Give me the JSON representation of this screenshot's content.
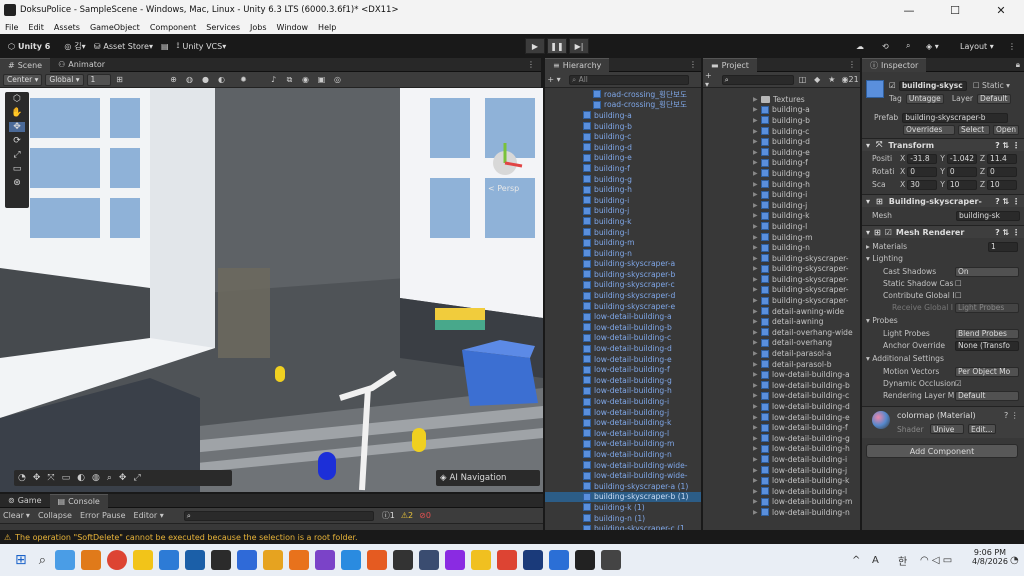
{
  "window": {
    "title": "DoksuPolice - SampleScene - Windows, Mac, Linux - Unity 6.3 LTS (6000.3.6f1)* <DX11>",
    "minimize": "—",
    "maximize": "☐",
    "close": "✕"
  },
  "menu": [
    "File",
    "Edit",
    "Assets",
    "GameObject",
    "Component",
    "Services",
    "Jobs",
    "Window",
    "Help"
  ],
  "toolbar": {
    "unity": "Unity 6",
    "account": "김",
    "asset_store": "Asset Store",
    "vcs": "Unity VCS",
    "layout": "Layout"
  },
  "scene": {
    "tab_scene": "Scene",
    "tab_animator": "Animator",
    "pivot": "Center",
    "space": "Global",
    "snap": "1",
    "persp": "< Persp",
    "ai_nav": "AI Navigation"
  },
  "game": {
    "tab_game": "Game",
    "tab_console": "Console",
    "clear": "Clear",
    "collapse": "Collapse",
    "error_pause": "Error Pause",
    "editor": "Editor",
    "warn": "2",
    "err": "0",
    "info": "1"
  },
  "hierarchy": {
    "title": "Hierarchy",
    "search": "All",
    "items": [
      "road-crossing_횡단보도",
      "road-crossing_횡단보도",
      "building-a",
      "building-b",
      "building-c",
      "building-d",
      "building-e",
      "building-f",
      "building-g",
      "building-h",
      "building-i",
      "building-j",
      "building-k",
      "building-l",
      "building-m",
      "building-n",
      "building-skyscraper-a",
      "building-skyscraper-b",
      "building-skyscraper-c",
      "building-skyscraper-d",
      "building-skyscraper-e",
      "low-detail-building-a",
      "low-detail-building-b",
      "low-detail-building-c",
      "low-detail-building-d",
      "low-detail-building-e",
      "low-detail-building-f",
      "low-detail-building-g",
      "low-detail-building-h",
      "low-detail-building-i",
      "low-detail-building-j",
      "low-detail-building-k",
      "low-detail-building-l",
      "low-detail-building-m",
      "low-detail-building-n",
      "low-detail-building-wide-",
      "low-detail-building-wide-",
      "building-skyscraper-a (1)",
      "building-skyscraper-b (1)",
      "building-k (1)",
      "building-n (1)",
      "building-skyscraper-c (1"
    ],
    "selected_index": 38
  },
  "project": {
    "title": "Project",
    "count": "21",
    "items": [
      "Textures",
      "building-a",
      "building-b",
      "building-c",
      "building-d",
      "building-e",
      "building-f",
      "building-g",
      "building-h",
      "building-i",
      "building-j",
      "building-k",
      "building-l",
      "building-m",
      "building-n",
      "building-skyscraper-",
      "building-skyscraper-",
      "building-skyscraper-",
      "building-skyscraper-",
      "building-skyscraper-",
      "detail-awning-wide",
      "detail-awning",
      "detail-overhang-wide",
      "detail-overhang",
      "detail-parasol-a",
      "detail-parasol-b",
      "low-detail-building-a",
      "low-detail-building-b",
      "low-detail-building-c",
      "low-detail-building-d",
      "low-detail-building-e",
      "low-detail-building-f",
      "low-detail-building-g",
      "low-detail-building-h",
      "low-detail-building-i",
      "low-detail-building-j",
      "low-detail-building-k",
      "low-detail-building-l",
      "low-detail-building-m",
      "low-detail-building-n"
    ]
  },
  "inspector": {
    "title": "Inspector",
    "name": "building-skysc",
    "static": "Static",
    "tag_label": "Tag",
    "tag": "Untagge",
    "layer_label": "Layer",
    "layer": "Default",
    "prefab_label": "Prefab",
    "prefab": "building-skyscraper-b",
    "overrides": "Overrides",
    "select": "Select",
    "open": "Open",
    "transform": "Transform",
    "pos_label": "Positi",
    "rot_label": "Rotati",
    "scale_label": "Sca",
    "pos": {
      "x": "-31.8",
      "y": "-1.042",
      "z": "11.4"
    },
    "rot": {
      "x": "0",
      "y": "0",
      "z": "0"
    },
    "scale": {
      "x": "30",
      "y": "10",
      "z": "10"
    },
    "meshfilter": "Building-skyscraper-",
    "mesh_label": "Mesh",
    "mesh": "building-sk",
    "meshrenderer": "Mesh Renderer",
    "materials": "Materials",
    "materials_count": "1",
    "lighting": "Lighting",
    "cast_shadows": "Cast Shadows",
    "cast_val": "On",
    "static_shadow": "Static Shadow Cas",
    "contrib_gi": "Contribute Global I",
    "receive_gi": "Receive Global I",
    "receive_val": "Light Probes",
    "probes": "Probes",
    "light_probes": "Light Probes",
    "light_probes_val": "Blend Probes",
    "anchor": "Anchor Override",
    "anchor_val": "None (Transfo",
    "additional": "Additional Settings",
    "motion": "Motion Vectors",
    "motion_val": "Per Object Mo",
    "dyn_occ": "Dynamic Occlusion",
    "render_layer": "Rendering Layer M",
    "render_layer_val": "Default",
    "material": "colormap (Material)",
    "shader_label": "Shader",
    "shader": "Unive",
    "edit": "Edit...",
    "add_component": "Add Component"
  },
  "status": {
    "message": "The operation \"SoftDelete\" cannot be executed because the selection is a root folder."
  },
  "taskbar": {
    "time": "9:06 PM",
    "date": "4/8/2026",
    "lang": "A",
    "ime": "한"
  }
}
